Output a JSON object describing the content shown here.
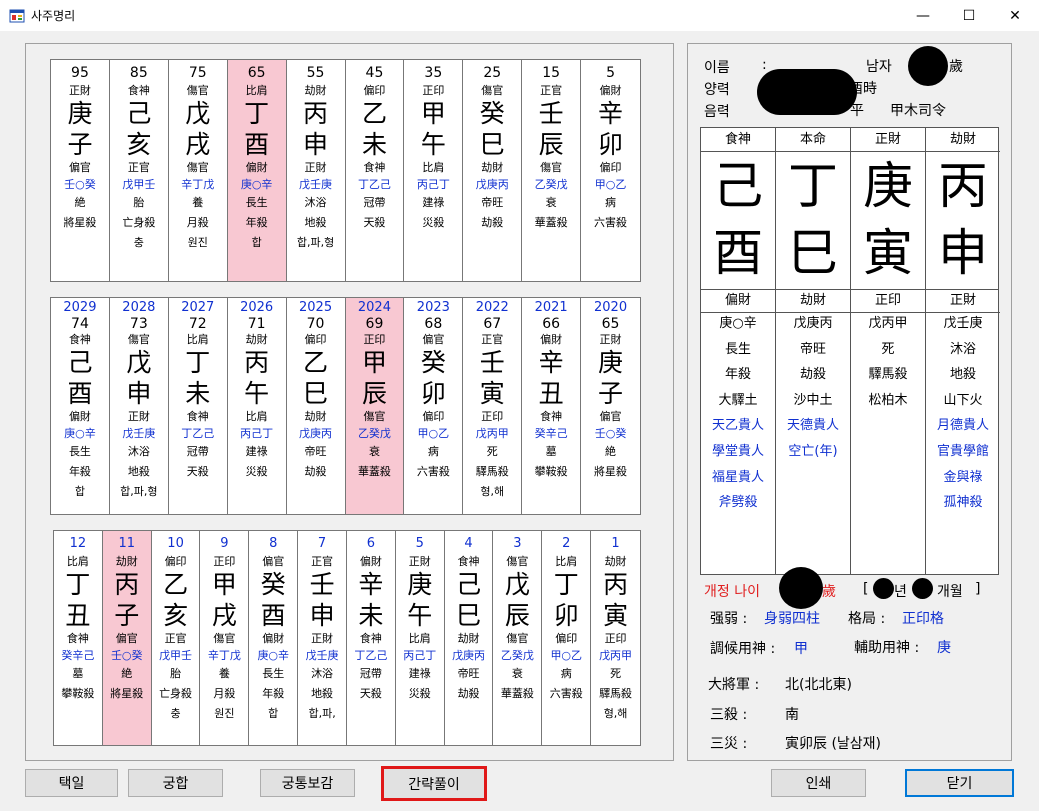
{
  "window": {
    "title": "사주명리",
    "min": "—",
    "max": "☐",
    "close": "✕"
  },
  "daeun": [
    {
      "num": "95",
      "top": "正財",
      "stem": "庚",
      "branch": "子",
      "sub": "偏官",
      "hidden": "壬○癸",
      "state": "絶",
      "sal": "將星殺",
      "extra": ""
    },
    {
      "num": "85",
      "top": "食神",
      "stem": "己",
      "branch": "亥",
      "sub": "正官",
      "hidden": "戊甲壬",
      "state": "胎",
      "sal": "亡身殺",
      "extra": "충"
    },
    {
      "num": "75",
      "top": "傷官",
      "stem": "戊",
      "branch": "戌",
      "sub": "傷官",
      "hidden": "辛丁戊",
      "state": "養",
      "sal": "月殺",
      "extra": "원진"
    },
    {
      "num": "65",
      "top": "比肩",
      "stem": "丁",
      "branch": "酉",
      "sub": "偏財",
      "hidden": "庚○辛",
      "state": "長生",
      "sal": "年殺",
      "extra": "합"
    },
    {
      "num": "55",
      "top": "劫財",
      "stem": "丙",
      "branch": "申",
      "sub": "正財",
      "hidden": "戊壬庚",
      "state": "沐浴",
      "sal": "地殺",
      "extra": "합,파,형"
    },
    {
      "num": "45",
      "top": "偏印",
      "stem": "乙",
      "branch": "未",
      "sub": "食神",
      "hidden": "丁乙己",
      "state": "冠帶",
      "sal": "天殺",
      "extra": ""
    },
    {
      "num": "35",
      "top": "正印",
      "stem": "甲",
      "branch": "午",
      "sub": "比肩",
      "hidden": "丙己丁",
      "state": "建祿",
      "sal": "災殺",
      "extra": ""
    },
    {
      "num": "25",
      "top": "傷官",
      "stem": "癸",
      "branch": "巳",
      "sub": "劫財",
      "hidden": "戊庚丙",
      "state": "帝旺",
      "sal": "劫殺",
      "extra": ""
    },
    {
      "num": "15",
      "top": "正官",
      "stem": "壬",
      "branch": "辰",
      "sub": "傷官",
      "hidden": "乙癸戊",
      "state": "衰",
      "sal": "華蓋殺",
      "extra": ""
    },
    {
      "num": "5",
      "top": "偏財",
      "stem": "辛",
      "branch": "卯",
      "sub": "偏印",
      "hidden": "甲○乙",
      "state": "病",
      "sal": "六害殺",
      "extra": ""
    }
  ],
  "seun": [
    {
      "year": "2029",
      "age": "74",
      "top": "食神",
      "stem": "己",
      "branch": "酉",
      "sub": "偏財",
      "hidden": "庚○辛",
      "state": "長生",
      "sal": "年殺",
      "extra": "합"
    },
    {
      "year": "2028",
      "age": "73",
      "top": "傷官",
      "stem": "戊",
      "branch": "申",
      "sub": "正財",
      "hidden": "戊壬庚",
      "state": "沐浴",
      "sal": "地殺",
      "extra": "합,파,형"
    },
    {
      "year": "2027",
      "age": "72",
      "top": "比肩",
      "stem": "丁",
      "branch": "未",
      "sub": "食神",
      "hidden": "丁乙己",
      "state": "冠帶",
      "sal": "天殺",
      "extra": ""
    },
    {
      "year": "2026",
      "age": "71",
      "top": "劫財",
      "stem": "丙",
      "branch": "午",
      "sub": "比肩",
      "hidden": "丙己丁",
      "state": "建祿",
      "sal": "災殺",
      "extra": ""
    },
    {
      "year": "2025",
      "age": "70",
      "top": "偏印",
      "stem": "乙",
      "branch": "巳",
      "sub": "劫財",
      "hidden": "戊庚丙",
      "state": "帝旺",
      "sal": "劫殺",
      "extra": ""
    },
    {
      "year": "2024",
      "age": "69",
      "top": "正印",
      "stem": "甲",
      "branch": "辰",
      "sub": "傷官",
      "hidden": "乙癸戊",
      "state": "衰",
      "sal": "華蓋殺",
      "extra": ""
    },
    {
      "year": "2023",
      "age": "68",
      "top": "偏官",
      "stem": "癸",
      "branch": "卯",
      "sub": "偏印",
      "hidden": "甲○乙",
      "state": "病",
      "sal": "六害殺",
      "extra": ""
    },
    {
      "year": "2022",
      "age": "67",
      "top": "正官",
      "stem": "壬",
      "branch": "寅",
      "sub": "正印",
      "hidden": "戊丙甲",
      "state": "死",
      "sal": "驛馬殺",
      "extra": "형,해"
    },
    {
      "year": "2021",
      "age": "66",
      "top": "偏財",
      "stem": "辛",
      "branch": "丑",
      "sub": "食神",
      "hidden": "癸辛己",
      "state": "墓",
      "sal": "攀鞍殺",
      "extra": ""
    },
    {
      "year": "2020",
      "age": "65",
      "top": "正財",
      "stem": "庚",
      "branch": "子",
      "sub": "偏官",
      "hidden": "壬○癸",
      "state": "絶",
      "sal": "將星殺",
      "extra": ""
    }
  ],
  "wolun": [
    {
      "num": "12",
      "top": "比肩",
      "stem": "丁",
      "branch": "丑",
      "sub": "食神",
      "hidden": "癸辛己",
      "state": "墓",
      "sal": "攀鞍殺",
      "extra": ""
    },
    {
      "num": "11",
      "top": "劫財",
      "stem": "丙",
      "branch": "子",
      "sub": "偏官",
      "hidden": "壬○癸",
      "state": "絶",
      "sal": "將星殺",
      "extra": ""
    },
    {
      "num": "10",
      "top": "偏印",
      "stem": "乙",
      "branch": "亥",
      "sub": "正官",
      "hidden": "戊甲壬",
      "state": "胎",
      "sal": "亡身殺",
      "extra": "충"
    },
    {
      "num": "9",
      "top": "正印",
      "stem": "甲",
      "branch": "戌",
      "sub": "傷官",
      "hidden": "辛丁戊",
      "state": "養",
      "sal": "月殺",
      "extra": "원진"
    },
    {
      "num": "8",
      "top": "偏官",
      "stem": "癸",
      "branch": "酉",
      "sub": "偏財",
      "hidden": "庚○辛",
      "state": "長生",
      "sal": "年殺",
      "extra": "합"
    },
    {
      "num": "7",
      "top": "正官",
      "stem": "壬",
      "branch": "申",
      "sub": "正財",
      "hidden": "戊壬庚",
      "state": "沐浴",
      "sal": "地殺",
      "extra": "합,파,"
    },
    {
      "num": "6",
      "top": "偏財",
      "stem": "辛",
      "branch": "未",
      "sub": "食神",
      "hidden": "丁乙己",
      "state": "冠帶",
      "sal": "天殺",
      "extra": ""
    },
    {
      "num": "5",
      "top": "正財",
      "stem": "庚",
      "branch": "午",
      "sub": "比肩",
      "hidden": "丙己丁",
      "state": "建祿",
      "sal": "災殺",
      "extra": ""
    },
    {
      "num": "4",
      "top": "食神",
      "stem": "己",
      "branch": "巳",
      "sub": "劫財",
      "hidden": "戊庚丙",
      "state": "帝旺",
      "sal": "劫殺",
      "extra": ""
    },
    {
      "num": "3",
      "top": "傷官",
      "stem": "戊",
      "branch": "辰",
      "sub": "傷官",
      "hidden": "乙癸戊",
      "state": "衰",
      "sal": "華蓋殺",
      "extra": ""
    },
    {
      "num": "2",
      "top": "比肩",
      "stem": "丁",
      "branch": "卯",
      "sub": "偏印",
      "hidden": "甲○乙",
      "state": "病",
      "sal": "六害殺",
      "extra": ""
    },
    {
      "num": "1",
      "top": "劫財",
      "stem": "丙",
      "branch": "寅",
      "sub": "正印",
      "hidden": "戊丙甲",
      "state": "死",
      "sal": "驛馬殺",
      "extra": "형,해"
    }
  ],
  "info": {
    "name_label": "이름",
    "solar_label": "양력",
    "lunar_label": "음력",
    "colon": ":",
    "gender": "남자",
    "age_suffix": "歲",
    "solar_suffix": "酉時",
    "lunar_suffix1": "平",
    "lunar_suffix2": "甲木司令"
  },
  "pillars": [
    {
      "head": "食神",
      "stem": "己",
      "branch": "酉",
      "sub": "偏財",
      "items": [
        {
          "t": "庚○辛",
          "b": false
        },
        {
          "t": "長生",
          "b": false
        },
        {
          "t": "年殺",
          "b": false
        },
        {
          "t": "大驛土",
          "b": false
        },
        {
          "t": "天乙貴人",
          "b": true
        },
        {
          "t": "學堂貴人",
          "b": true
        },
        {
          "t": "福星貴人",
          "b": true
        },
        {
          "t": "斧劈殺",
          "b": true
        }
      ]
    },
    {
      "head": "本命",
      "stem": "丁",
      "branch": "巳",
      "sub": "劫財",
      "items": [
        {
          "t": "戊庚丙",
          "b": false
        },
        {
          "t": "帝旺",
          "b": false
        },
        {
          "t": "劫殺",
          "b": false
        },
        {
          "t": "沙中土",
          "b": false
        },
        {
          "t": "天德貴人",
          "b": true
        },
        {
          "t": "空亡(年)",
          "b": true
        }
      ]
    },
    {
      "head": "正財",
      "stem": "庚",
      "branch": "寅",
      "sub": "正印",
      "items": [
        {
          "t": "戊丙甲",
          "b": false
        },
        {
          "t": "死",
          "b": false
        },
        {
          "t": "驛馬殺",
          "b": false
        },
        {
          "t": "松柏木",
          "b": false
        }
      ]
    },
    {
      "head": "劫財",
      "stem": "丙",
      "branch": "申",
      "sub": "正財",
      "items": [
        {
          "t": "戊壬庚",
          "b": false
        },
        {
          "t": "沐浴",
          "b": false
        },
        {
          "t": "地殺",
          "b": false
        },
        {
          "t": "山下火",
          "b": false
        },
        {
          "t": "月德貴人",
          "b": true
        },
        {
          "t": "官貴學館",
          "b": true
        },
        {
          "t": "金與祿",
          "b": true
        },
        {
          "t": "孤神殺",
          "b": true
        }
      ]
    }
  ],
  "analysis": {
    "age_label": "개정 나이",
    "age_suffix": "歲",
    "bracket_open": "[",
    "year_suffix": "년",
    "month_suffix": "개월",
    "bracket_close": "]",
    "strength_label": "强弱 :",
    "strength_value": "身弱四柱",
    "geok_label": "格局 :",
    "geok_value": "正印格",
    "johu_label": "調候用神 :",
    "johu_value": "甲",
    "bojo_label": "輔助用神 :",
    "bojo_value": "庚",
    "daejang_label": "大將軍 :",
    "daejang_value": "北(北北東)",
    "samsal_label": "三殺 :",
    "samsal_value": "南",
    "samjae_label": "三災 :",
    "samjae_value": "寅卯辰 (날삼재)"
  },
  "buttons": {
    "taegil": "택일",
    "gunghap": "궁합",
    "gungtong": "궁통보감",
    "ganryak": "간략풀이",
    "print": "인쇄",
    "close": "닫기"
  }
}
